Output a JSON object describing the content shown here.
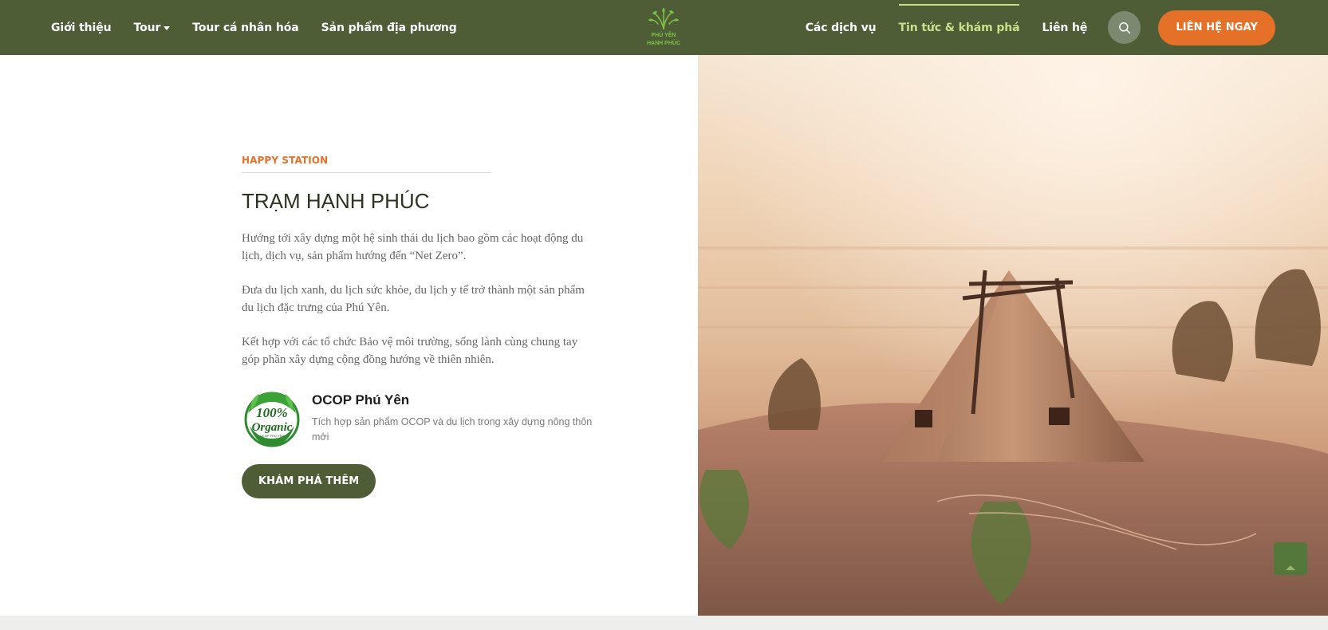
{
  "nav": {
    "left": [
      "Giới thiệu",
      "Tour",
      "Tour cá nhân hóa",
      "Sản phẩm địa phương"
    ],
    "right": [
      "Các dịch vụ",
      "Tin tức & khám phá",
      "Liên hệ"
    ],
    "active": "Tin tức & khám phá",
    "cta_label": "LIÊN HỆ NGAY"
  },
  "logo": {
    "text_top": "PHÚ YÊN",
    "text_bottom": "HẠNH PHÚC"
  },
  "section": {
    "eyebrow": "HAPPY STATION",
    "title": "TRẠM HẠNH PHÚC",
    "paragraphs": [
      "Hướng tới xây dựng một hệ sinh thái du lịch bao gồm các hoạt động du lịch, dịch vụ, sản phẩm hướng đến “Net Zero”.",
      "Đưa du lịch xanh, du lịch sức khỏe, du lịch y tế trở thành một sản phẩm du lịch đặc trưng của Phú Yên.",
      "Kết hợp với các tổ chức Bảo vệ môi trường, sống lành cùng chung tay góp phần xây dựng cộng đồng hướng về thiên nhiên."
    ],
    "ocop": {
      "title": "OCOP Phú Yên",
      "description": "Tích hợp sản phẩm OCOP và du lịch trong xây dựng nông thôn mới",
      "badge_line1": "100%",
      "badge_line2": "Organic",
      "badge_line3": "OCOP PHÚ YÊN"
    },
    "button_label": "KHÁM PHÁ THÊM"
  },
  "colors": {
    "header_bg": "#4e5d36",
    "accent_orange": "#e57128",
    "active_nav": "#c9e08a"
  }
}
